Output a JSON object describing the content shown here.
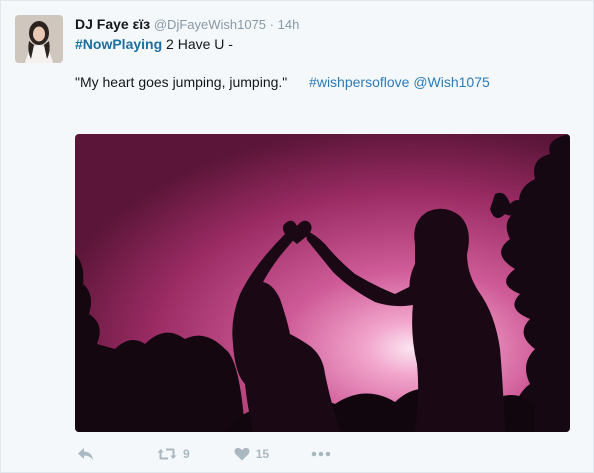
{
  "tweet": {
    "display_name": "DJ Faye",
    "display_suffix": " εïз",
    "screen_name": "@DjFayeWish1075",
    "separator": " · ",
    "time": "14h",
    "hashtag_now_playing": "#NowPlaying",
    "song": " 2 Have U -",
    "quote": "\"My heart goes jumping, jumping.\"",
    "hashtag_wish": "#wishpersoflove",
    "mention": "@Wish1075",
    "retweet_count": "9",
    "like_count": "15"
  },
  "icons": {
    "reply": "reply-icon",
    "retweet": "retweet-icon",
    "like": "heart-icon",
    "more": "more-icon"
  },
  "colors": {
    "link": "#2b7bb9",
    "action_gray": "#aab8c2",
    "photo_sky": "#c0407a"
  }
}
